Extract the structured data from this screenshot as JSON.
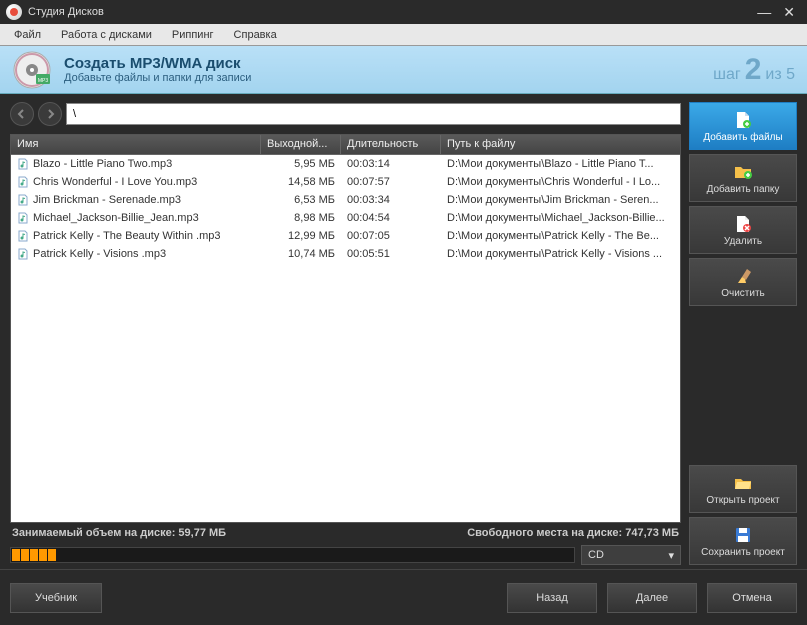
{
  "titlebar": {
    "app_name": "Студия Дисков"
  },
  "menubar": {
    "file": "Файл",
    "disks": "Работа с дисками",
    "ripping": "Риппинг",
    "help": "Справка"
  },
  "header": {
    "title": "Создать MP3/WMA диск",
    "subtitle": "Добавьте файлы и папки для записи",
    "step_prefix": "шаг",
    "step_num": "2",
    "step_of": "из 5"
  },
  "nav": {
    "path": "\\"
  },
  "table": {
    "columns": {
      "name": "Имя",
      "size": "Выходной...",
      "duration": "Длительность",
      "path": "Путь к файлу"
    },
    "rows": [
      {
        "name": "Blazo - Little Piano Two.mp3",
        "size": "5,95 МБ",
        "duration": "00:03:14",
        "path": "D:\\Мои документы\\Blazo - Little Piano T..."
      },
      {
        "name": "Chris Wonderful - I Love You.mp3",
        "size": "14,58 МБ",
        "duration": "00:07:57",
        "path": "D:\\Мои документы\\Chris Wonderful - I Lo..."
      },
      {
        "name": "Jim Brickman - Serenade.mp3",
        "size": "6,53 МБ",
        "duration": "00:03:34",
        "path": "D:\\Мои документы\\Jim Brickman - Seren..."
      },
      {
        "name": "Michael_Jackson-Billie_Jean.mp3",
        "size": "8,98 МБ",
        "duration": "00:04:54",
        "path": "D:\\Мои документы\\Michael_Jackson-Billie..."
      },
      {
        "name": "Patrick Kelly - The Beauty Within .mp3",
        "size": "12,99 МБ",
        "duration": "00:07:05",
        "path": "D:\\Мои документы\\Patrick Kelly - The Be..."
      },
      {
        "name": "Patrick Kelly - Visions .mp3",
        "size": "10,74 МБ",
        "duration": "00:05:51",
        "path": "D:\\Мои документы\\Patrick Kelly - Visions ..."
      }
    ]
  },
  "status": {
    "left": "Занимаемый объем на диске: 59,77 МБ",
    "right": "Свободного места на диске: 747,73 МБ"
  },
  "drive": {
    "selected": "CD"
  },
  "sidebar": {
    "add_files": "Добавить файлы",
    "add_folder": "Добавить папку",
    "delete": "Удалить",
    "clear": "Очистить",
    "open_project": "Открыть проект",
    "save_project": "Сохранить проект"
  },
  "footer": {
    "tutorial": "Учебник",
    "back": "Назад",
    "next": "Далее",
    "cancel": "Отмена"
  }
}
